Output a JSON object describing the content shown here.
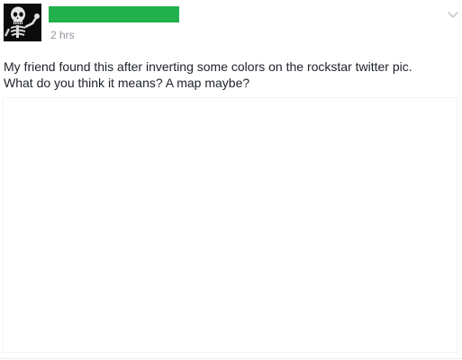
{
  "post": {
    "timestamp": "2 hrs",
    "text_line_1": "My friend found this after inverting some colors on the rockstar twitter pic.",
    "text_line_2": "What do you think it means? A map maybe?"
  },
  "colors": {
    "name_redaction": "#22b14c",
    "text": "#1d2129",
    "timestamp": "#90949c"
  },
  "icons": {
    "avatar": "skeleton-avatar",
    "menu": "chevron-down-icon"
  }
}
